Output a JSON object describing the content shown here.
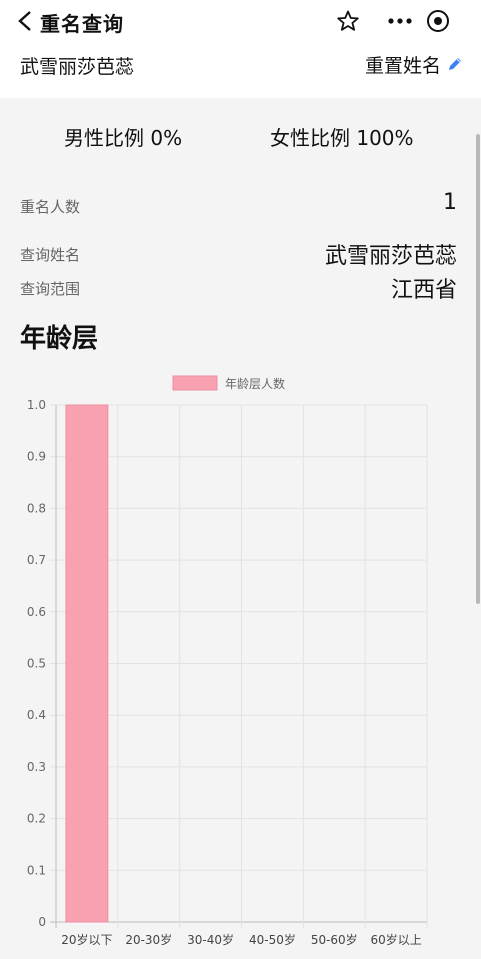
{
  "topbar": {
    "title": "重名查询"
  },
  "query": {
    "name": "武雪丽莎芭蕊",
    "reset_label": "重置姓名"
  },
  "ratio": {
    "male": "男性比例 0%",
    "female": "女性比例 100%"
  },
  "info": {
    "count_label": "重名人数",
    "count_value": "1",
    "name_label": "查询姓名",
    "name_value": "武雪丽莎芭蕊",
    "range_label": "查询范围",
    "range_value": "江西省"
  },
  "section_title": "年龄层",
  "colors": {
    "bar": "#f7a1b1",
    "accent": "#3b82f6"
  },
  "icons": [
    "chevron-left-icon",
    "star-icon",
    "more-icon",
    "target-icon",
    "edit-pencil-icon"
  ],
  "chart_data": {
    "type": "bar",
    "categories": [
      "20岁以下",
      "20-30岁",
      "30-40岁",
      "40-50岁",
      "50-60岁",
      "60岁以上"
    ],
    "series": [
      {
        "name": "年龄层人数",
        "values": [
          1,
          0,
          0,
          0,
          0,
          0
        ]
      }
    ],
    "ylim": [
      0,
      1
    ],
    "yticks": [
      "1.0",
      "0.9",
      "0.8",
      "0.7",
      "0.6",
      "0.5",
      "0.4",
      "0.3",
      "0.2",
      "0.1",
      "0"
    ],
    "grid": true,
    "legend": "top-center"
  }
}
